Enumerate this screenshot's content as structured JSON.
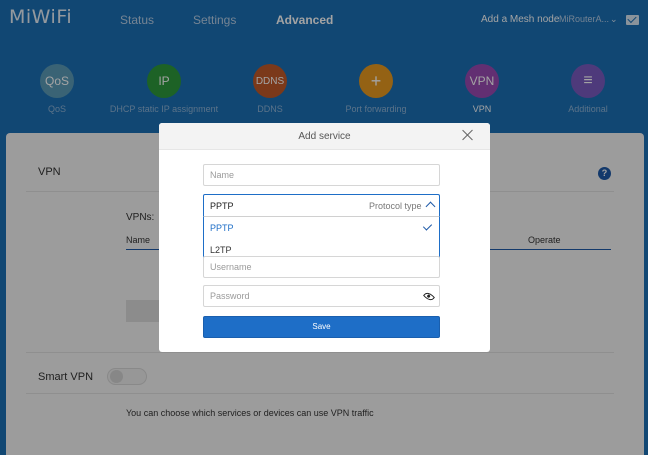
{
  "header": {
    "logo": "MiWiFi",
    "nav": [
      "Status",
      "Settings",
      "Advanced"
    ],
    "active_nav": "Advanced",
    "mesh_link": "Add a Mesh node",
    "router_name": "MiRouterA...",
    "router_chevron": "⌄"
  },
  "services": [
    {
      "icon_text": "QoS",
      "label": "QoS",
      "color": "#5b9bb8"
    },
    {
      "icon_text": "IP",
      "label": "DHCP static IP assignment",
      "color": "#2e9a3c"
    },
    {
      "icon_text": "DDNS",
      "label": "DDNS",
      "color": "#c05a2a"
    },
    {
      "icon_text": "+",
      "label": "Port forwarding",
      "color": "#e89a20"
    },
    {
      "icon_text": "VPN",
      "label": "VPN",
      "color": "#9a4ab3"
    },
    {
      "icon_text": "≡",
      "label": "Additional",
      "color": "#7a5cc0"
    }
  ],
  "panel": {
    "title": "VPN",
    "help": "?",
    "vpns_label": "VPNs:",
    "columns": {
      "name": "Name",
      "operate": "Operate"
    },
    "smart_vpn": "Smart VPN",
    "smart_vpn_hint": "You can choose which services or devices can use VPN traffic"
  },
  "modal": {
    "title": "Add service",
    "name_placeholder": "Name",
    "protocol": {
      "value": "PPTP",
      "label": "Protocol type",
      "options": [
        "PPTP",
        "L2TP"
      ],
      "selected": "PPTP"
    },
    "username_placeholder": "Username",
    "password_placeholder": "Password",
    "save_label": "Save"
  },
  "colors": {
    "accent": "#1e6ec7",
    "header": "#1b6fb5"
  }
}
